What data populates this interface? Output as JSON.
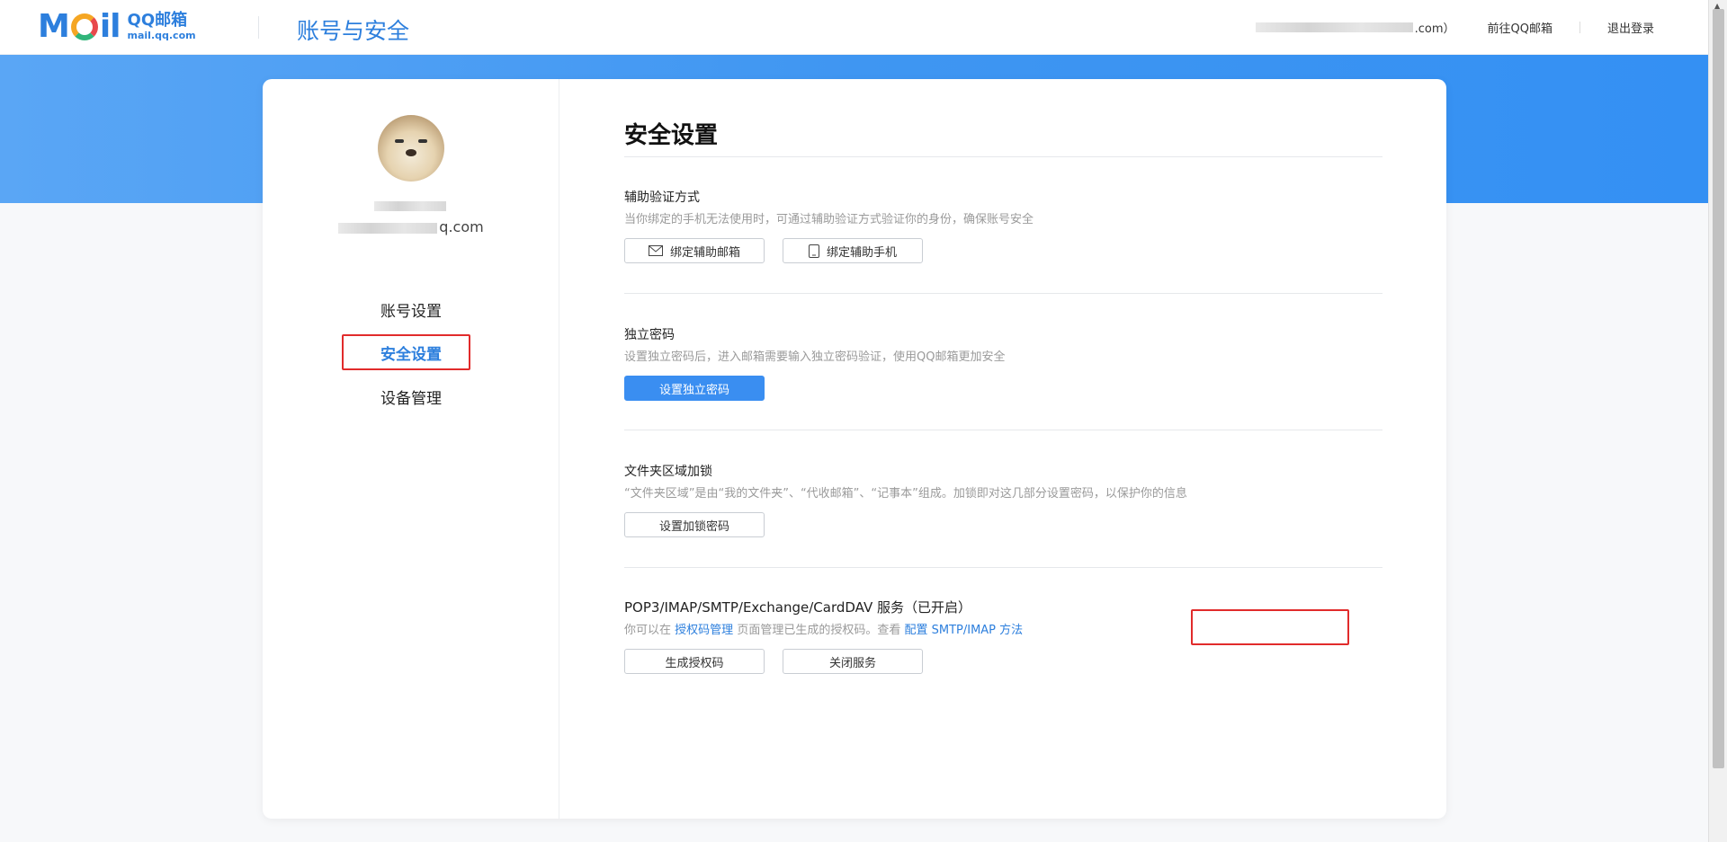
{
  "header": {
    "logo_text": "Mail",
    "logo_zh": "QQ邮箱",
    "logo_en": "mail.qq.com",
    "page_title": "账号与安全",
    "account_suffix": ".com）",
    "goto_mail": "前往QQ邮箱",
    "logout": "退出登录"
  },
  "sidebar": {
    "email_suffix": "q.com",
    "nav": [
      {
        "label": "账号设置"
      },
      {
        "label": "安全设置"
      },
      {
        "label": "设备管理"
      }
    ]
  },
  "content": {
    "heading": "安全设置",
    "sections": [
      {
        "title": "辅助验证方式",
        "desc": "当你绑定的手机无法使用时，可通过辅助验证方式验证你的身份，确保账号安全",
        "buttons": [
          "绑定辅助邮箱",
          "绑定辅助手机"
        ]
      },
      {
        "title": "独立密码",
        "desc": "设置独立密码后，进入邮箱需要输入独立密码验证，使用QQ邮箱更加安全",
        "buttons": [
          "设置独立密码"
        ]
      },
      {
        "title": "文件夹区域加锁",
        "desc": "“文件夹区域”是由“我的文件夹”、“代收邮箱”、“记事本”组成。加锁即对这几部分设置密码，以保护你的信息",
        "buttons": [
          "设置加锁密码"
        ]
      },
      {
        "title": "POP3/IMAP/SMTP/Exchange/CardDAV 服务（已开启）",
        "desc_prefix": "你可以在",
        "desc_link1": "授权码管理",
        "desc_middle": "页面管理已生成的授权码。查看",
        "desc_link2": "配置 SMTP/IMAP 方法",
        "buttons": [
          "生成授权码",
          "关闭服务"
        ]
      }
    ]
  },
  "colors": {
    "accent": "#2d7fdd",
    "band": "#3f96f2",
    "highlight": "#e12b2b"
  },
  "icons": {
    "mail": "mail-icon",
    "phone": "phone-icon"
  }
}
